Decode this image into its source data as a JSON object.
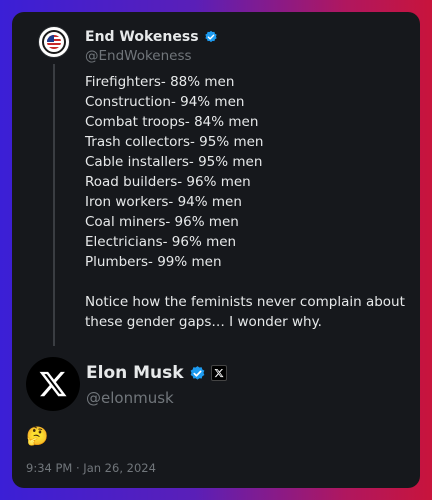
{
  "quoted_post": {
    "author_name": "End Wokeness",
    "author_handle": "@EndWokeness",
    "lines": [
      "Firefighters- 88% men",
      "Construction- 94% men",
      "Combat troops- 84% men",
      "Trash collectors- 95% men",
      "Cable installers- 95% men",
      "Road builders- 96% men",
      "Iron workers- 94% men",
      "Coal miners- 96% men",
      "Electricians- 96% men",
      "Plumbers- 99% men"
    ],
    "closing": "Notice how the feminists never complain about these gender gaps… I wonder why."
  },
  "reply_post": {
    "author_name": "Elon Musk",
    "author_handle": "@elonmusk",
    "text": "🤔",
    "timestamp": "9:34 PM · Jan 26, 2024"
  },
  "icons": {
    "verified": "verified-badge-icon",
    "affiliation": "x-logo-icon"
  },
  "colors": {
    "verified_blue": "#1d9bf0",
    "card_bg": "#16181c",
    "text_primary": "#e7e9ea",
    "text_secondary": "#71767b"
  }
}
